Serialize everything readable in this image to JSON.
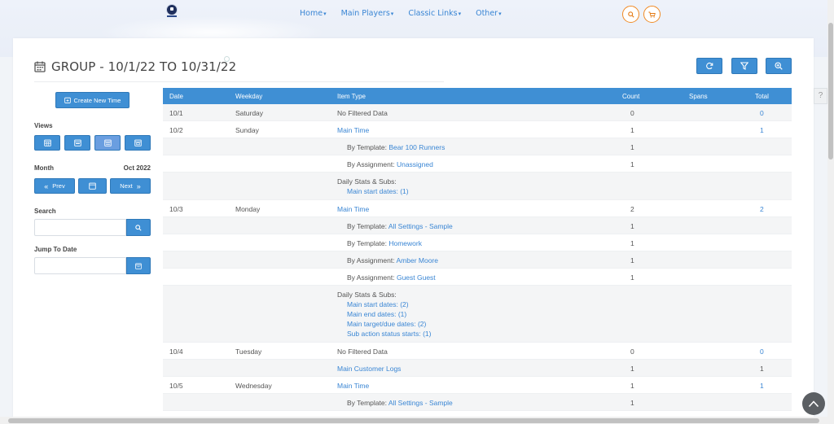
{
  "nav": {
    "items": [
      "Home",
      "Main Players",
      "Classic Links",
      "Other"
    ],
    "chevron": "▾"
  },
  "page": {
    "title": "GROUP - 10/1/22 TO 10/31/22"
  },
  "sidebar": {
    "create_label": "Create New Time",
    "views_label": "Views",
    "month_label": "Month",
    "month_value": "Oct 2022",
    "prev_label": "Prev",
    "next_label": "Next",
    "search_label": "Search",
    "jump_label": "Jump To Date"
  },
  "table": {
    "headers": {
      "date": "Date",
      "weekday": "Weekday",
      "item_type": "Item Type",
      "count": "Count",
      "spans": "Spans",
      "total": "Total"
    },
    "rows": [
      {
        "date": "10/1",
        "weekday": "Saturday",
        "item": "No Filtered Data",
        "count": "0",
        "total": "0"
      },
      {
        "date": "10/2",
        "weekday": "Sunday",
        "item": "Main Time",
        "count": "1",
        "total": "1"
      },
      {
        "prefix": "By Template: ",
        "link": "Bear 100 Runners",
        "count": "1"
      },
      {
        "prefix": "By Assignment: ",
        "link": "Unassigned",
        "count": "1"
      },
      {
        "stats_label": "Daily Stats & Subs:",
        "stats": [
          "Main start dates: (1)"
        ]
      },
      {
        "date": "10/3",
        "weekday": "Monday",
        "item": "Main Time",
        "count": "2",
        "total": "2"
      },
      {
        "prefix": "By Template: ",
        "link": "All Settings - Sample",
        "count": "1"
      },
      {
        "prefix": "By Template: ",
        "link": "Homework",
        "count": "1"
      },
      {
        "prefix": "By Assignment: ",
        "link": "Amber Moore",
        "count": "1"
      },
      {
        "prefix": "By Assignment: ",
        "link": "Guest Guest",
        "count": "1"
      },
      {
        "stats_label": "Daily Stats & Subs:",
        "stats": [
          "Main start dates: (2)",
          "Main end dates: (1)",
          "Main target/due dates: (2)",
          "Sub action status starts: (1)"
        ]
      },
      {
        "date": "10/4",
        "weekday": "Tuesday",
        "item": "No Filtered Data",
        "count": "0",
        "total": "0"
      },
      {
        "item_link": "Main Customer Logs",
        "count": "1",
        "total": "1"
      },
      {
        "date": "10/5",
        "weekday": "Wednesday",
        "item": "Main Time",
        "count": "1",
        "total": "1"
      },
      {
        "prefix": "By Template: ",
        "link": "All Settings - Sample",
        "count": "1"
      }
    ]
  },
  "help": {
    "label": "?"
  },
  "colors": {
    "accent": "#3f8fd4",
    "link": "#3a86d4",
    "cart": "#f08a24"
  },
  "icons": [
    "calendar-icon",
    "refresh-icon",
    "filter-icon",
    "zoom-in-icon",
    "search-icon",
    "cart-icon",
    "arrow-up-icon"
  ]
}
